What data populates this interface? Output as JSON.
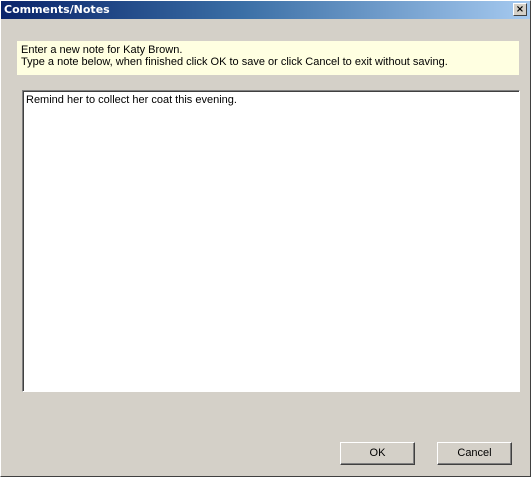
{
  "window": {
    "title": "Comments/Notes",
    "close_glyph": "×",
    "close_icon": "close-icon"
  },
  "info": {
    "line1": "Enter a new note for Katy Brown.",
    "line2": "Type a note below, when finished click OK to save or click Cancel to exit without saving."
  },
  "note": {
    "value": "Remind her to collect her coat this evening."
  },
  "buttons": {
    "ok_label": "OK",
    "cancel_label": "Cancel"
  },
  "colors": {
    "title_start": "#0a246a",
    "title_end": "#a6caf0",
    "dialog_bg": "#d4d0c8",
    "info_bg": "#ffffe1"
  }
}
